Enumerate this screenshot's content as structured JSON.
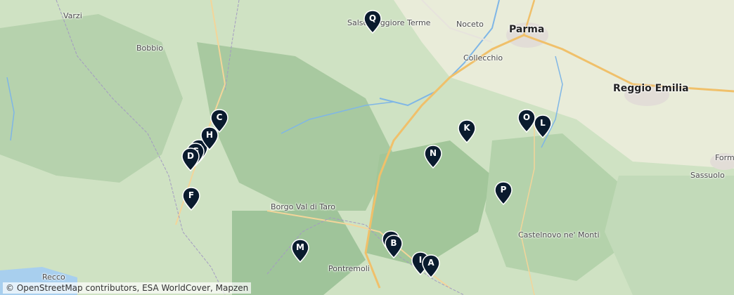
{
  "map": {
    "colors": {
      "land": "#cfe2c3",
      "forest": "#9fc49a",
      "urban": "#e7e3dd",
      "river": "#7fb6e6",
      "sea": "#a8cfee",
      "road": "#f0c06a",
      "marker": "#0a1b2e"
    },
    "places": {
      "varzi": "Varzi",
      "bobbio": "Bobbio",
      "salsomaggiore": "Salsomaggiore Terme",
      "noceto": "Noceto",
      "parma": "Parma",
      "collecchio": "Collecchio",
      "reggio": "Reggio Emilia",
      "form": "Form",
      "sassuolo": "Sassuolo",
      "borgo": "Borgo Val di Taro",
      "castelnovo": "Castelnovo ne' Monti",
      "pontremoli": "Pontremoli",
      "recco": "Recco"
    },
    "markers": {
      "a": "A",
      "b": "B",
      "c": "C",
      "d": "D",
      "f": "F",
      "h": "H",
      "i": "I",
      "k": "K",
      "l": "L",
      "m": "M",
      "n": "N",
      "o": "O",
      "p": "P",
      "q": "Q",
      "e": "E",
      "g": "G",
      "j": "J"
    },
    "attribution": "© OpenStreetMap contributors, ESA WorldCover, Mapzen"
  }
}
